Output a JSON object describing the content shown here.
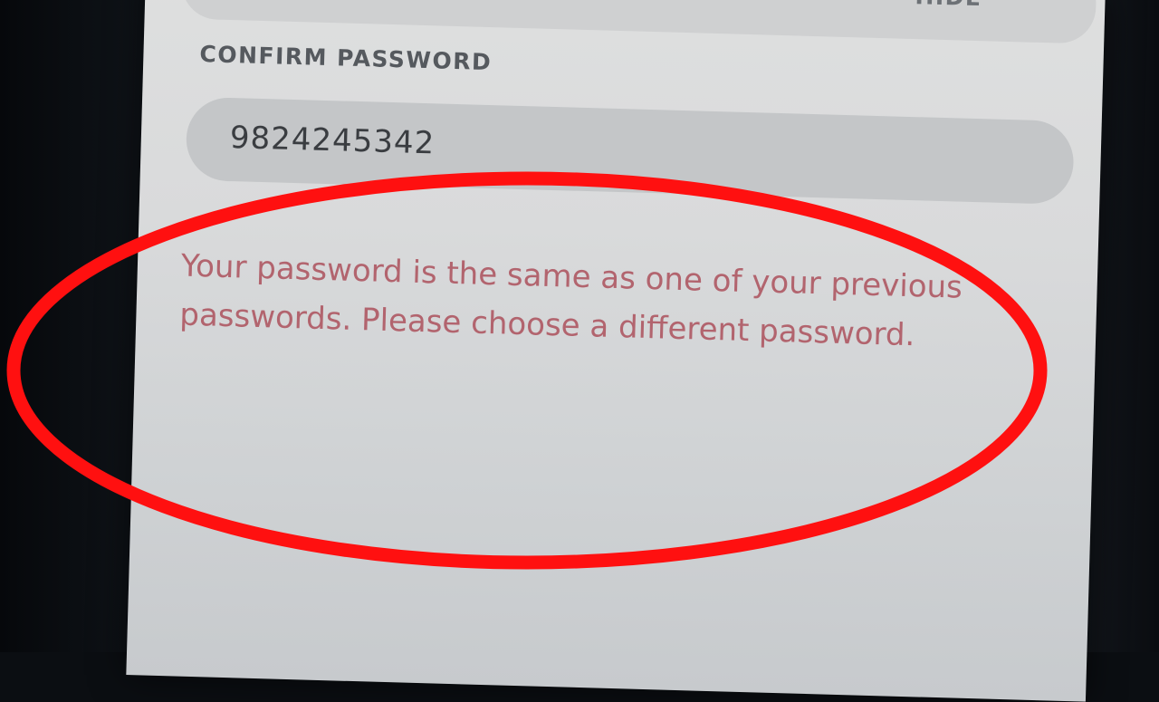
{
  "form": {
    "toggle_label": "HIDE",
    "alert_icon": "!",
    "confirm_label": "CONFIRM PASSWORD",
    "confirm_value": "9824245342",
    "error_message": "Your password is the same as one of your previous passwords. Please choose a different password."
  },
  "colors": {
    "annotation_ring": "#ff1010",
    "error_text": "#b2646e",
    "alert": "#c9364a"
  },
  "icons": {
    "alert": "exclamation-icon"
  }
}
